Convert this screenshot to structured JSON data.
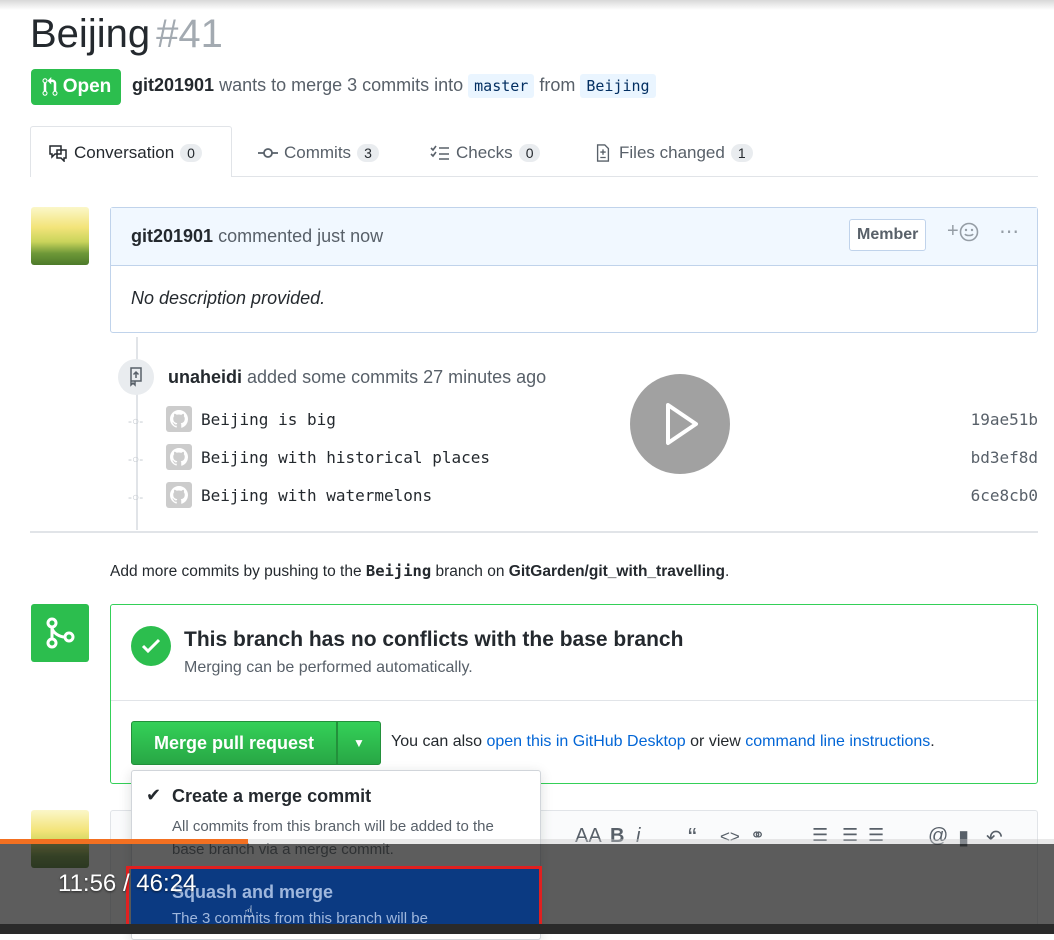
{
  "pr": {
    "title": "Beijing",
    "number": "#41",
    "state": "Open",
    "author": "git201901",
    "meta_mid": " wants to merge 3 commits into ",
    "base_branch": "master",
    "meta_from": " from ",
    "head_branch": "Beijing"
  },
  "tabs": [
    {
      "label": "Conversation",
      "count": "0",
      "icon": "comment-icon"
    },
    {
      "label": "Commits",
      "count": "3",
      "icon": "commit-icon"
    },
    {
      "label": "Checks",
      "count": "0",
      "icon": "checks-icon"
    },
    {
      "label": "Files changed",
      "count": "1",
      "icon": "file-diff-icon"
    }
  ],
  "comment": {
    "author": "git201901",
    "action": " commented just now",
    "badge": "Member",
    "reaction": "+",
    "body": "No description provided."
  },
  "timeline": {
    "actor": "unaheidi",
    "action": " added some commits 27 minutes ago",
    "commits": [
      {
        "message": "Beijing is big",
        "sha": "19ae51b"
      },
      {
        "message": "Beijing with historical places",
        "sha": "bd3ef8d"
      },
      {
        "message": "Beijing with watermelons",
        "sha": "6ce8cb0"
      }
    ]
  },
  "push_note": {
    "prefix": "Add more commits by pushing to the ",
    "branch": "Beijing",
    "mid": " branch on ",
    "repo": "GitGarden/git_with_travelling",
    "suffix": "."
  },
  "merge": {
    "title": "This branch has no conflicts with the base branch",
    "subtitle": "Merging can be performed automatically.",
    "button": "Merge pull request",
    "also_prefix": "You can also ",
    "desktop_link": "open this in GitHub Desktop",
    "also_mid": " or view ",
    "cli_link": "command line instructions",
    "also_suffix": "."
  },
  "dropdown": {
    "selected_title": "Create a merge commit",
    "selected_desc": "All commits from this branch will be added to the base branch via a merge commit.",
    "item2_title": "Squash and merge",
    "item2_desc": "The 3 commits from this branch will be"
  },
  "toolbar": {
    "heading": "AA",
    "bold": "B",
    "italic": "i",
    "quote": "“",
    "code": "<>",
    "mention": "@"
  },
  "player": {
    "time": "11:56 / 46:24",
    "progress": 0.235
  },
  "colors": {
    "open_green": "#2cbe4e",
    "link_blue": "#0366d6",
    "progress_orange": "#f37021",
    "highlight_red": "#e02020"
  }
}
